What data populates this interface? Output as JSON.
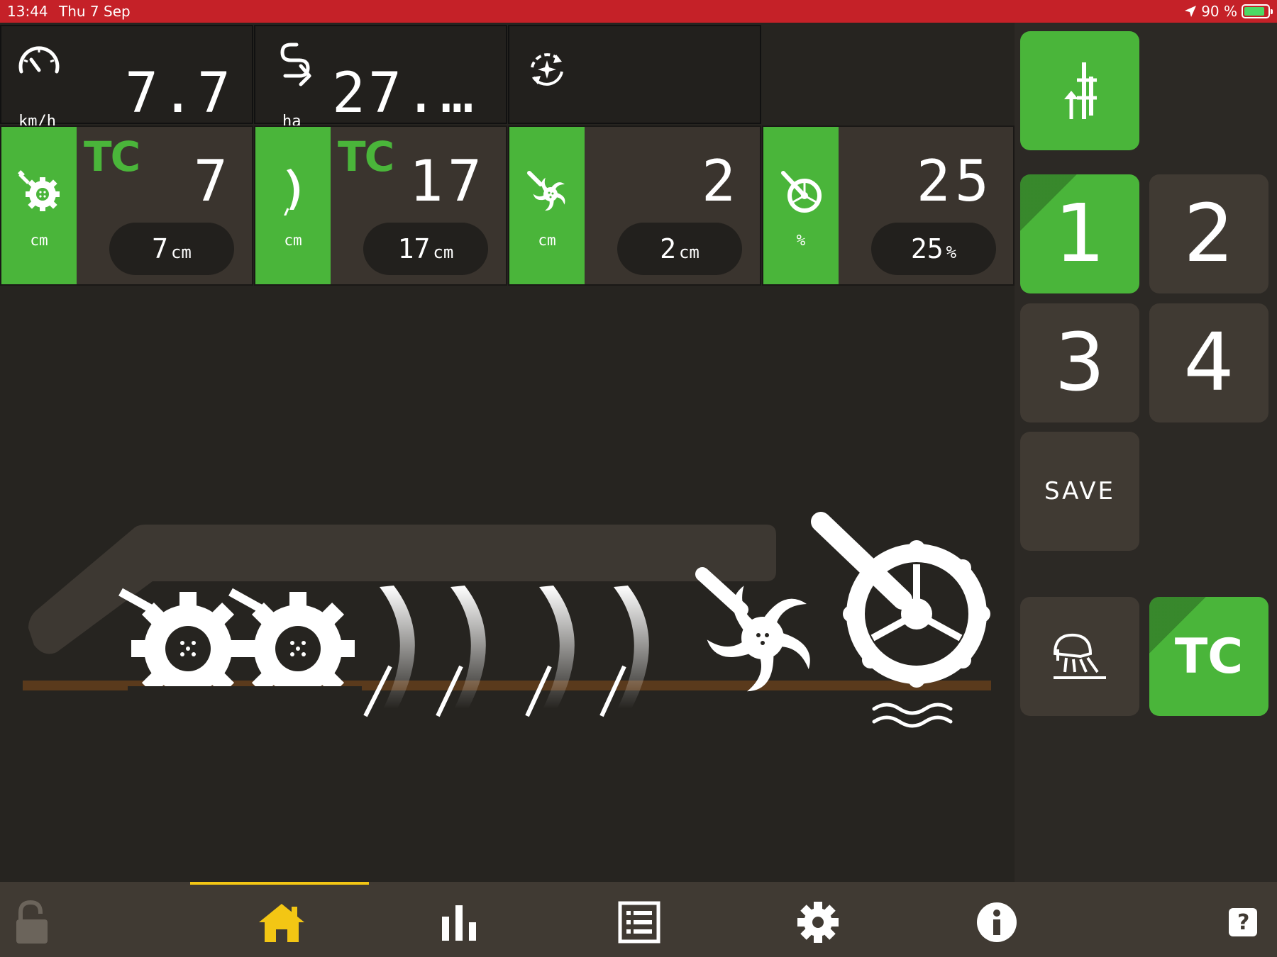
{
  "status_bar": {
    "time": "13:44",
    "date": "Thu 7 Sep",
    "battery": "90 %",
    "battery_level": 0.9
  },
  "info_tiles": [
    {
      "icon": "speedometer-icon",
      "unit": "km/h",
      "value": "7.7"
    },
    {
      "icon": "area-path-icon",
      "unit": "ha",
      "value": "27.…"
    },
    {
      "icon": "auto-cycle-icon",
      "unit": "",
      "value": ""
    }
  ],
  "sections": [
    {
      "icon": "depth-wheel-icon",
      "unit": "cm",
      "tc": "TC",
      "value": "7",
      "pill_value": "7",
      "pill_unit": "cm"
    },
    {
      "icon": "disc-blade-icon",
      "unit": "cm",
      "tc": "TC",
      "value": "17",
      "pill_value": "17",
      "pill_unit": "cm"
    },
    {
      "icon": "rotor-icon",
      "unit": "cm",
      "tc": "",
      "value": "2",
      "pill_value": "2",
      "pill_unit": "cm"
    },
    {
      "icon": "press-roller-icon",
      "unit": "%",
      "tc": "",
      "value": "25",
      "pill_value": "25",
      "pill_unit": "%"
    }
  ],
  "right_panel": {
    "lift_button_icon": "lift-control-icon",
    "presets": [
      "1",
      "2",
      "3",
      "4"
    ],
    "selected_preset": "1",
    "save_label": "SAVE",
    "work_light_icon": "work-light-icon",
    "tc_label": "TC"
  },
  "bottom_nav": {
    "items": [
      "lock-icon",
      "home-icon",
      "bar-chart-icon",
      "list-icon",
      "gear-icon",
      "info-icon",
      "help-icon"
    ],
    "active": "home-icon",
    "help_label": "?"
  },
  "colors": {
    "accent_green": "#4ab53a",
    "status_red": "#c52128",
    "nav_active": "#f3c614",
    "soil": "#5a3a1c"
  }
}
